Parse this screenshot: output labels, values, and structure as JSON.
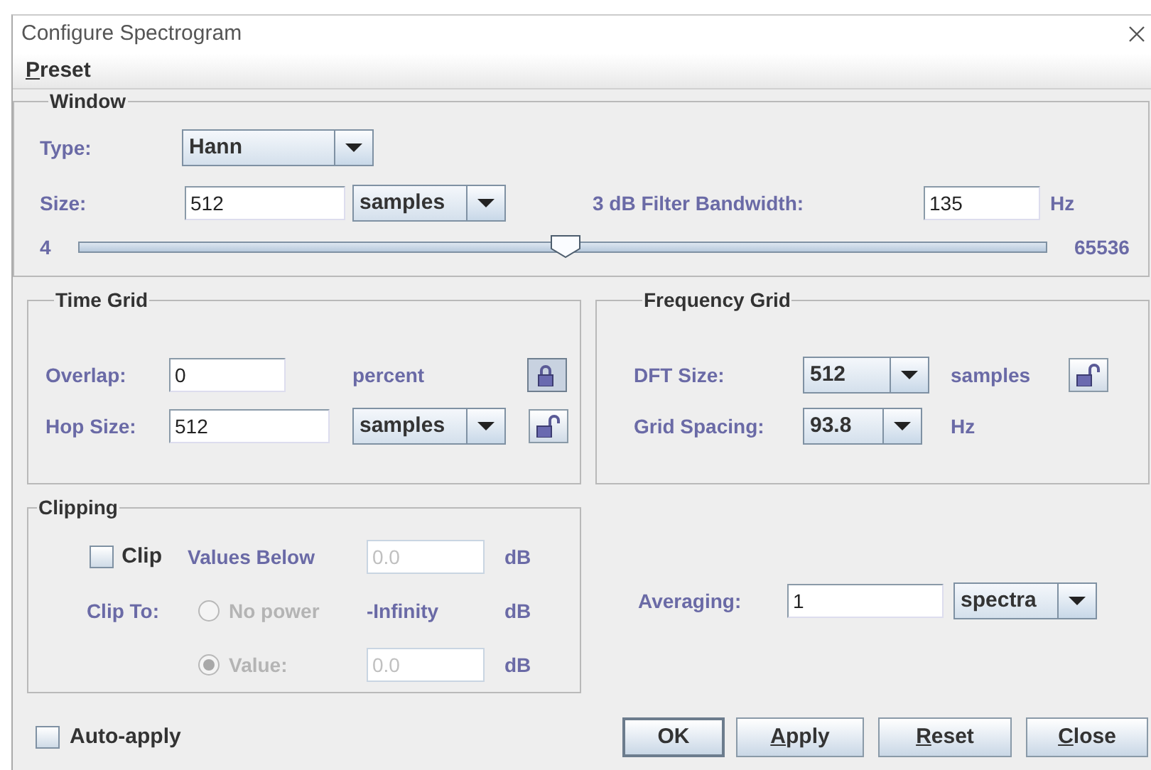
{
  "window": {
    "title": "Configure Spectrogram"
  },
  "menu": [
    {
      "label": "Preset",
      "mnemonic": true
    }
  ],
  "window_panel": {
    "title": "Window",
    "type": {
      "label": "Type:",
      "value": "Hann"
    },
    "size": {
      "label": "Size:",
      "value": "512",
      "unit": "samples"
    },
    "bandwidth": {
      "label": "3 dB Filter Bandwidth:",
      "value": "135",
      "unit": "Hz"
    },
    "slider": {
      "min": "4",
      "max": "65536",
      "level": 0.503
    }
  },
  "time_grid": {
    "title": "Time Grid",
    "overlap": {
      "label": "Overlap:",
      "value": "0",
      "unit": "percent",
      "locked": true
    },
    "hop_size": {
      "label": "Hop Size:",
      "value": "512",
      "unit": "samples",
      "locked": false
    }
  },
  "frequency_grid": {
    "title": "Frequency Grid",
    "dft_size": {
      "label": "DFT Size:",
      "value": "512",
      "unit": "samples",
      "locked": false
    },
    "grid_spacing": {
      "label": "Grid Spacing:",
      "value": "93.8",
      "unit": "Hz"
    }
  },
  "clipping": {
    "title": "Clipping",
    "clip": {
      "label": "Clip",
      "checked": false
    },
    "values_below": {
      "label": "Values Below",
      "value": "0.0",
      "unit": "dB",
      "disabled": true
    },
    "clip_to": {
      "label": "Clip To:",
      "options": [
        {
          "kind": "reading",
          "label": "No power",
          "reading": "-Infinity",
          "unit": "dB",
          "selected": false,
          "disabled": true
        },
        {
          "kind": "field",
          "label": "Value:",
          "value": "0.0",
          "unit": "dB",
          "selected": true,
          "disabled": true
        }
      ]
    }
  },
  "averaging": {
    "label": "Averaging:",
    "value": "1",
    "unit": "spectra"
  },
  "auto_apply": {
    "label": "Auto-apply",
    "checked": false
  },
  "buttons": [
    {
      "label": "OK",
      "mnemonic": false,
      "default": true
    },
    {
      "label": "Apply",
      "mnemonic": true,
      "default": false
    },
    {
      "label": "Reset",
      "mnemonic": true,
      "default": false
    },
    {
      "label": "Close",
      "mnemonic": true,
      "default": false
    }
  ]
}
